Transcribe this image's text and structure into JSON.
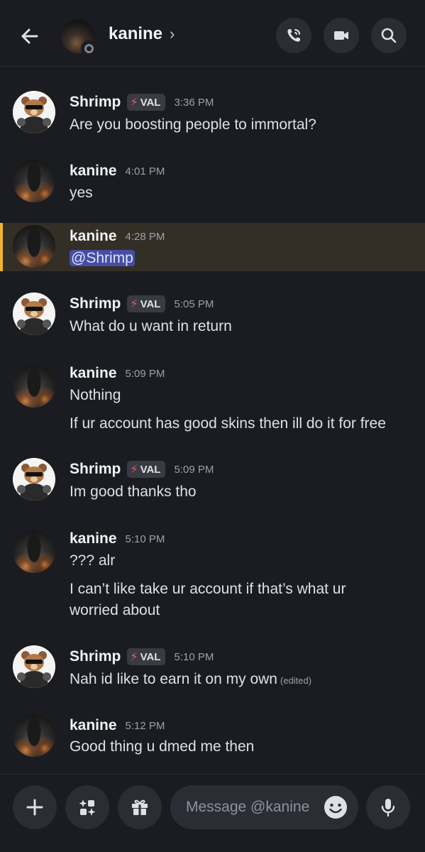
{
  "header": {
    "name": "kanine",
    "chevron": "›",
    "icons": [
      "back-arrow-icon",
      "phone-call-icon",
      "video-camera-icon",
      "search-icon"
    ]
  },
  "colors": {
    "background": "#1b1c21",
    "mention_bg": "#454ea3",
    "highlight_bar": "#f0b232",
    "highlight_bg": "#332e26",
    "bolt": "#ef5a5a"
  },
  "messages": [
    {
      "user": "Shrimp",
      "tag": "VAL",
      "time": "3:36 PM",
      "lines": [
        "Are you boosting people to immortal?"
      ]
    },
    {
      "user": "kanine",
      "time": "4:01 PM",
      "lines": [
        "yes"
      ]
    },
    {
      "user": "kanine",
      "time": "4:28 PM",
      "mention": "@Shrimp"
    },
    {
      "user": "Shrimp",
      "tag": "VAL",
      "time": "5:05 PM",
      "lines": [
        "What do u want in return"
      ]
    },
    {
      "user": "kanine",
      "time": "5:09 PM",
      "lines": [
        "Nothing",
        "If ur account has good skins then ill do it for free"
      ]
    },
    {
      "user": "Shrimp",
      "tag": "VAL",
      "time": "5:09 PM",
      "lines": [
        "Im good thanks tho"
      ]
    },
    {
      "user": "kanine",
      "time": "5:10 PM",
      "lines": [
        "??? alr",
        "I can’t like take ur account if that’s what ur",
        "worried about"
      ]
    },
    {
      "user": "Shrimp",
      "tag": "VAL",
      "time": "5:10 PM",
      "lines": [
        "Nah id like to earn it on my own"
      ],
      "edited": "(edited)"
    },
    {
      "user": "kanine",
      "time": "5:12 PM",
      "lines": [
        "Good thing u dmed me then"
      ]
    }
  ],
  "composer": {
    "placeholder": "Message @kanine",
    "icons": [
      "plus-icon",
      "apps-icon",
      "gift-icon",
      "emoji-icon",
      "microphone-icon"
    ]
  }
}
